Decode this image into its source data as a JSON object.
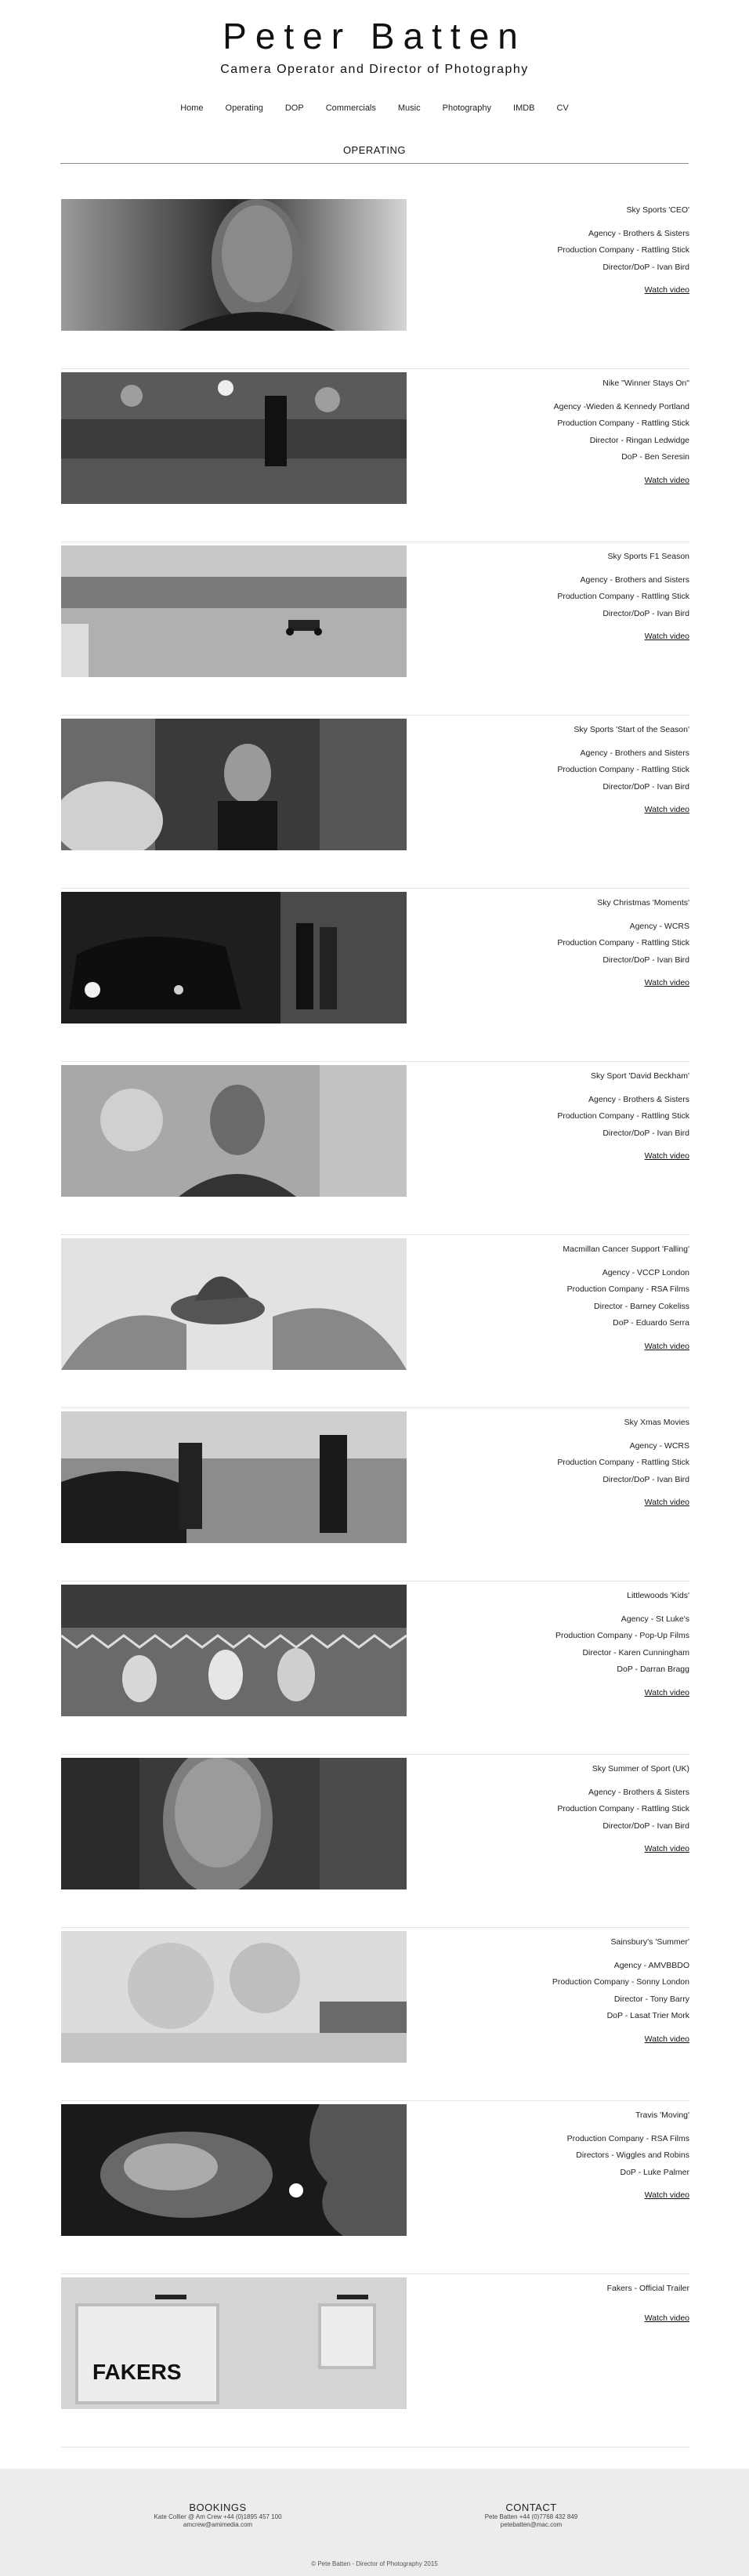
{
  "header": {
    "title": "Peter Batten",
    "subtitle": "Camera Operator and Director of Photography"
  },
  "nav": [
    "Home",
    "Operating",
    "DOP",
    "Commercials",
    "Music",
    "Photography",
    "IMDB",
    "CV"
  ],
  "section": {
    "title": "OPERATING"
  },
  "watch_label": "Watch video",
  "items": [
    {
      "title": "Sky Sports 'CEO'",
      "credits": [
        "Agency - Brothers & Sisters",
        "Production Company - Rattling Stick",
        "Director/DoP - Ivan Bird"
      ],
      "image": "man-portrait-closeup"
    },
    {
      "title": "Nike \"Winner Stays On\"",
      "credits": [
        "Agency -Wieden & Kennedy Portland",
        "Production Company - Rattling Stick",
        "Director - Ringan Ledwidge",
        "DoP - Ben Seresin"
      ],
      "image": "footballer-stadium"
    },
    {
      "title": "Sky Sports F1 Season",
      "credits": [
        "Agency - Brothers and Sisters",
        "Production Company - Rattling Stick",
        "Director/DoP - Ivan Bird"
      ],
      "image": "f1-car-track"
    },
    {
      "title": "Sky Sports 'Start of the Season'",
      "credits": [
        "Agency - Brothers and Sisters",
        "Production Company - Rattling Stick",
        "Director/DoP - Ivan Bird"
      ],
      "image": "boy-in-crowd"
    },
    {
      "title": "Sky Christmas 'Moments'",
      "credits": [
        "Agency - WCRS",
        "Production Company - Rattling Stick",
        "Director/DoP - Ivan Bird"
      ],
      "image": "taxi-night-street"
    },
    {
      "title": "Sky Sport 'David Beckham'",
      "credits": [
        "Agency - Brothers & Sisters",
        "Production Company - Rattling Stick",
        "Director/DoP - Ivan Bird"
      ],
      "image": "man-portrait-flowers"
    },
    {
      "title": "Macmillan Cancer Support 'Falling'",
      "credits": [
        "Agency - VCCP London",
        "Production Company - RSA Films",
        "Director - Barney Cokeliss",
        "DoP - Eduardo Serra"
      ],
      "image": "playground-sky"
    },
    {
      "title": "Sky Xmas Movies",
      "credits": [
        "Agency - WCRS",
        "Production Company - Rattling Stick",
        "Director/DoP - Ivan Bird"
      ],
      "image": "snow-street"
    },
    {
      "title": "Littlewoods 'Kids'",
      "credits": [
        "Agency - St Luke's",
        "Production Company - Pop-Up Films",
        "Director - Karen Cunningham",
        "DoP - Darran Bragg"
      ],
      "image": "kids-bunting"
    },
    {
      "title": "Sky Summer of Sport (UK)",
      "credits": [
        "Agency - Brothers & Sisters",
        "Production Company - Rattling Stick",
        "Director/DoP - Ivan Bird"
      ],
      "image": "man-face-closeup"
    },
    {
      "title": "Sainsbury's 'Summer'",
      "credits": [
        "Agency - AMVBBDO",
        "Production Company - Sonny London",
        "Director - Tony Barry",
        "DoP - Lasat Trier Mork"
      ],
      "image": "trees-bright"
    },
    {
      "title": "Travis 'Moving'",
      "credits": [
        "Production Company - RSA Films",
        "Directors - Wiggles and Robins",
        "DoP - Luke Palmer"
      ],
      "image": "smoke-profile"
    },
    {
      "title": "Fakers - Official Trailer",
      "credits": [],
      "image": "fakers-sign",
      "image_text": "FAKERS"
    }
  ],
  "footer": {
    "bookings": {
      "heading": "BOOKINGS",
      "lines": [
        "Kate Collier @ Am Crew +44 (0)1895 457 100",
        "amcrew@amimedia.com"
      ]
    },
    "contact": {
      "heading": "CONTACT",
      "lines": [
        "Pete Batten +44 (0)7768 432 849",
        "petebatten@mac.com"
      ]
    },
    "copyright": "© Pete Batten - Director of Photography 2015"
  }
}
